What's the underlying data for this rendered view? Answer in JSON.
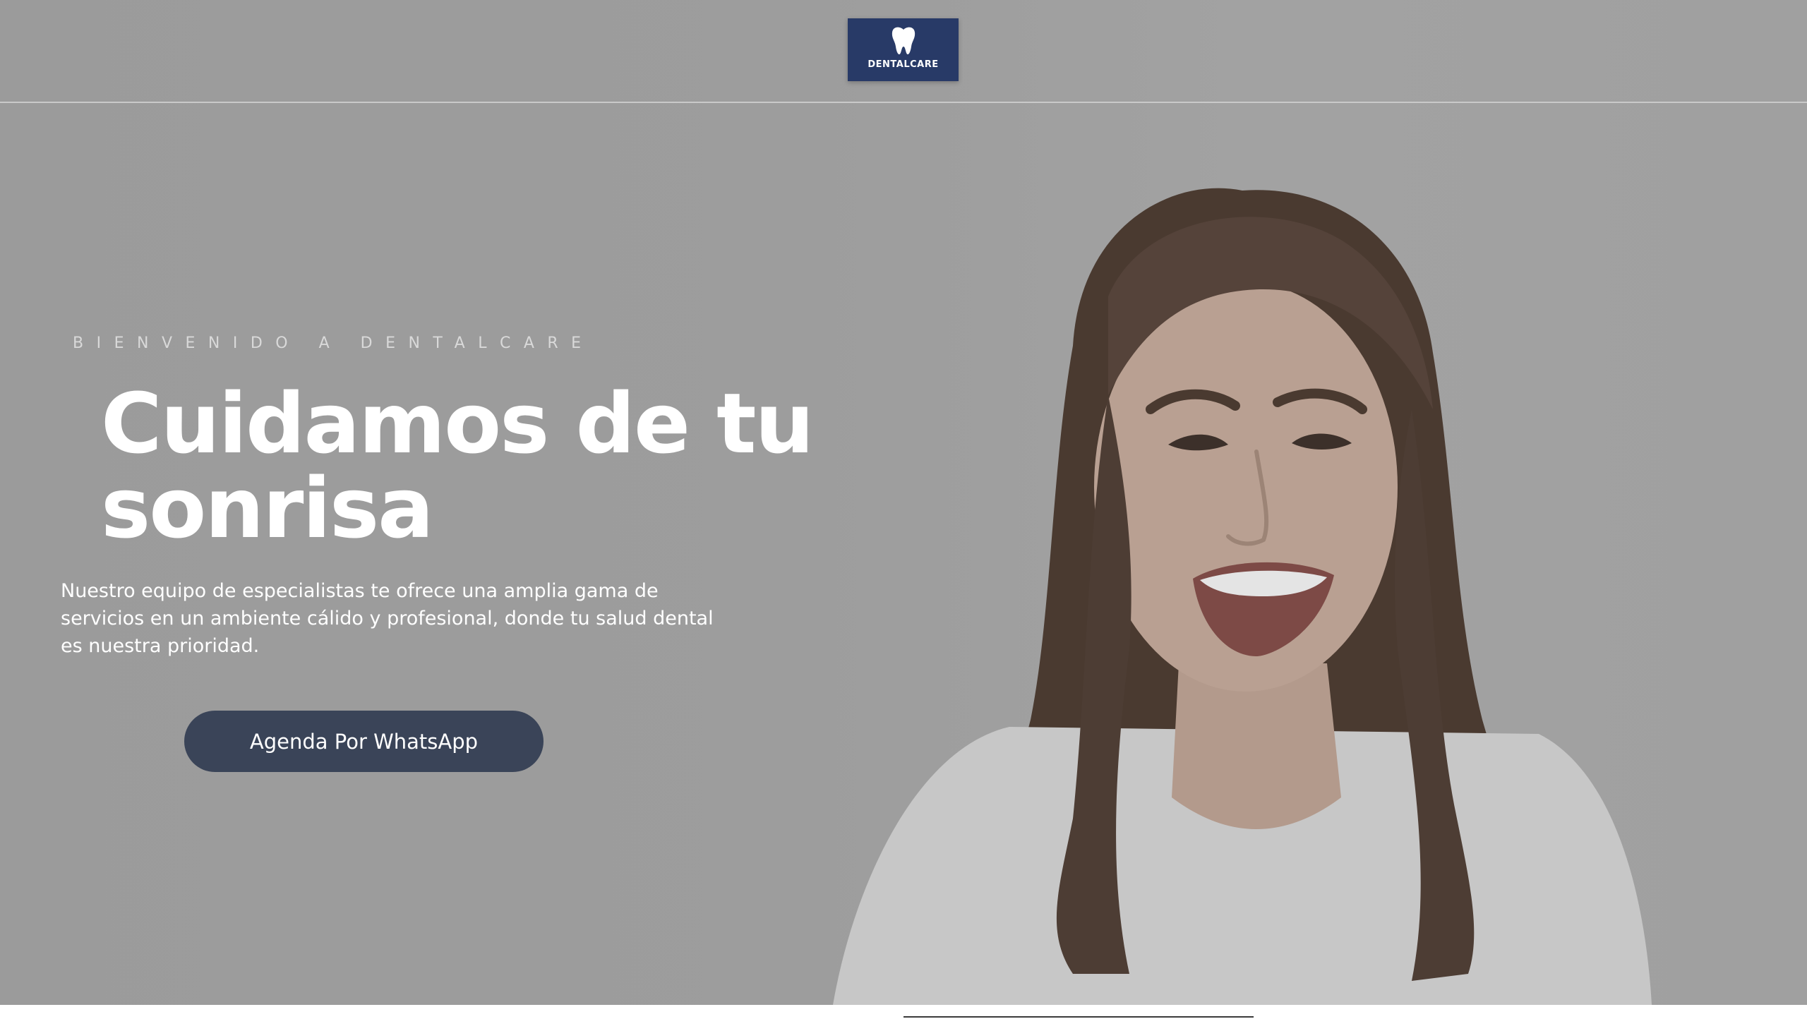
{
  "brand": {
    "logo_text": "DENTALCARE",
    "logo_color": "#283a67",
    "logo_icon": "tooth-icon"
  },
  "hero": {
    "eyebrow": "BIENVENIDO A DENTALCARE",
    "headline": "Cuidamos de tu sonrisa",
    "description": "Nuestro equipo de especialistas te ofrece una amplia gama de servicios en un ambiente cálido y profesional, donde tu salud dental es nuestra prioridad.",
    "cta_label": "Agenda Por WhatsApp",
    "cta_color": "#3a4458",
    "overlay_color": "#9c9c9c"
  }
}
